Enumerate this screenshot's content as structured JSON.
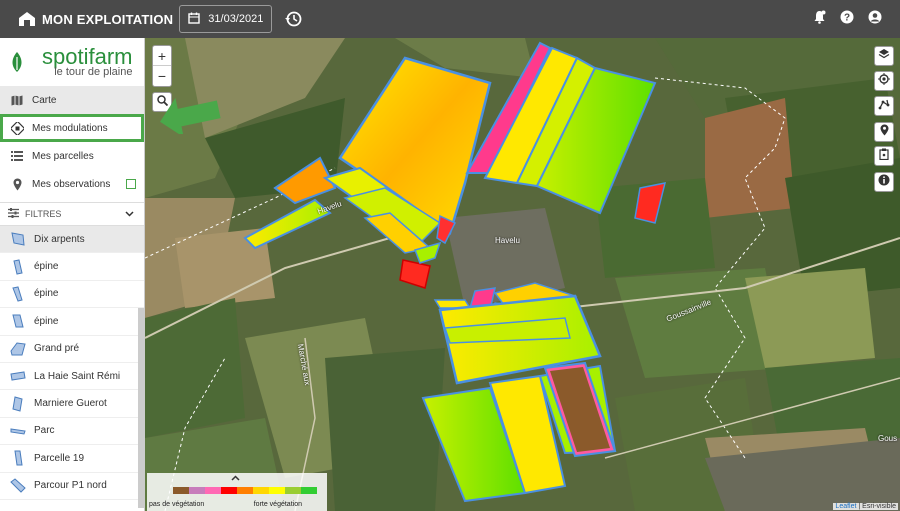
{
  "topbar": {
    "title": "MON EXPLOITATION",
    "date": "31/03/2021",
    "icons": [
      "farm-icon",
      "calendar-icon",
      "history-icon",
      "notification-icon",
      "help-icon",
      "user-icon"
    ]
  },
  "sidebar": {
    "brand": "spotifarm",
    "tagline": "le tour de plaine",
    "nav": [
      {
        "label": "Carte",
        "icon": "map-icon"
      },
      {
        "label": "Mes modulations",
        "icon": "modulation-icon"
      },
      {
        "label": "Mes parcelles",
        "icon": "list-icon"
      },
      {
        "label": "Mes observations",
        "icon": "pin-icon"
      }
    ],
    "filters_label": "FILTRES",
    "parcels": [
      {
        "name": "Dix arpents"
      },
      {
        "name": "épine"
      },
      {
        "name": "épine"
      },
      {
        "name": "épine"
      },
      {
        "name": "Grand pré"
      },
      {
        "name": "La Haie Saint Rémi"
      },
      {
        "name": "Marniere Guerot"
      },
      {
        "name": "Parc"
      },
      {
        "name": "Parcelle 19"
      },
      {
        "name": "Parcour P1 nord"
      }
    ]
  },
  "map": {
    "zoom_in": "+",
    "zoom_out": "−",
    "labels": {
      "village": "Havelu",
      "road1": "Havelu",
      "road2": "Goussainville",
      "road3": "Gous",
      "road4": "Marché aux"
    },
    "legend": {
      "low": "pas de végétation",
      "high": "forte végétation",
      "colors": [
        "#8b5a2b",
        "#c77dbb",
        "#ff69b4",
        "#ff0000",
        "#ff7f00",
        "#ffd700",
        "#ffff00",
        "#9acd32",
        "#32cd32"
      ]
    },
    "attribution_link": "Leaflet",
    "attribution_text": " | Esri-visible"
  }
}
